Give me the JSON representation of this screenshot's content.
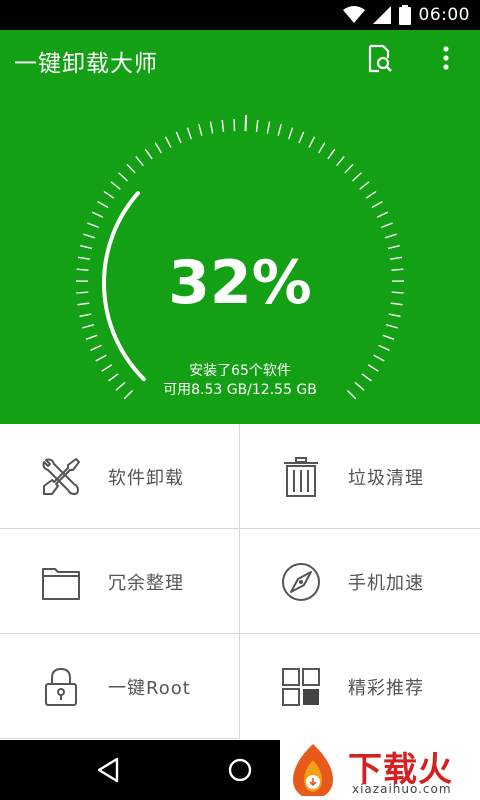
{
  "status_bar": {
    "time": "06:00"
  },
  "app_bar": {
    "title": "一键卸载大师"
  },
  "summary": {
    "percent": "32%",
    "apps_installed": "安装了65个软件",
    "storage": "可用8.53 GB/12.55 GB"
  },
  "gauge": {
    "usage_fraction": 0.32
  },
  "features": [
    {
      "label": "软件卸载",
      "icon": "wrench-screwdriver-icon"
    },
    {
      "label": "垃圾清理",
      "icon": "trash-icon"
    },
    {
      "label": "冗余整理",
      "icon": "folder-icon"
    },
    {
      "label": "手机加速",
      "icon": "compass-icon"
    },
    {
      "label": "一键Root",
      "icon": "lock-icon"
    },
    {
      "label": "精彩推荐",
      "icon": "grid-icon"
    }
  ],
  "watermark": {
    "brand": "下载火",
    "domain": "xiazaihuo.com"
  },
  "colors": {
    "primary": "#14a014",
    "watermark": "#d62020"
  }
}
